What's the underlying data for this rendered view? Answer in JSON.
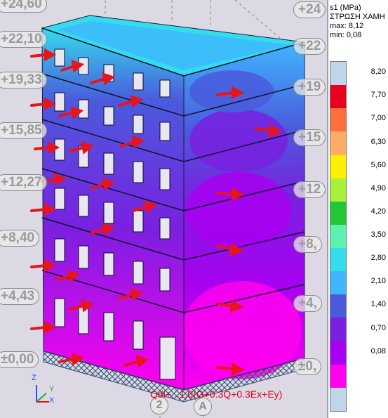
{
  "viewport": {
    "levels": [
      "+24,60",
      "+22,10",
      "+19,33",
      "+15,85",
      "+12,27",
      "+8,40",
      "+4,43",
      "±0,00"
    ],
    "levels_right": [
      "+24",
      "+22",
      "+19",
      "+15",
      "+12",
      "+8,",
      "+4,",
      "±0,"
    ],
    "load_combination": "Qdl+...1.0(G+0.3Q+0.3Ex+Ey)",
    "grid_labels": [
      "2",
      "A"
    ],
    "axes": {
      "z": "Z",
      "y": "Y",
      "x": "X"
    }
  },
  "legend": {
    "title": "s1 (MPa)",
    "subtitle": "ΣΤΡΩΣΗ ΧΑΜΗ",
    "max_label": "max: 8,12",
    "min_label": "min: 0,08",
    "ticks": [
      "8,20",
      "7,70",
      "7,00",
      "6,30",
      "5,60",
      "4,90",
      "4,20",
      "3,50",
      "2,80",
      "2,10",
      "1,40",
      "0,70",
      "0,08"
    ],
    "colors": [
      "#c0d4ea",
      "#e8001e",
      "#ff6f3c",
      "#ffad66",
      "#ffef00",
      "#a8f03c",
      "#22c834",
      "#5ef0b0",
      "#35dcec",
      "#3fb6ff",
      "#4a5bdc",
      "#7a20e0",
      "#a800f0",
      "#ff00f0",
      "#c0d4ea"
    ]
  }
}
